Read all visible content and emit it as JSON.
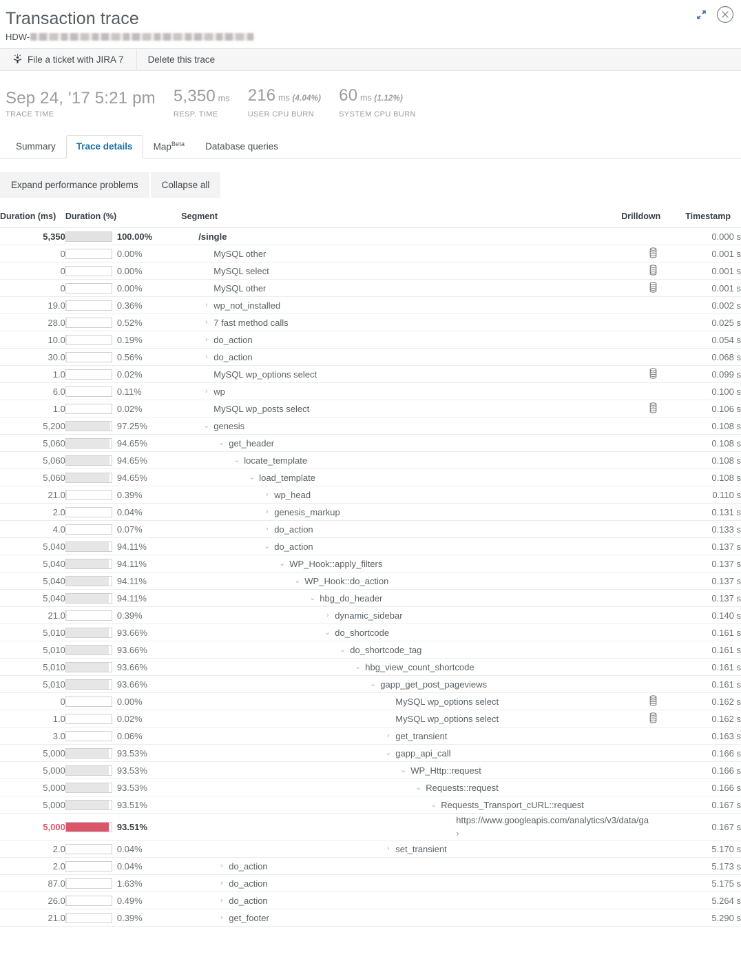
{
  "window": {
    "title": "Transaction trace",
    "subtitle_prefix": "HDW-",
    "expand_icon": "expand-arrows-icon",
    "close_icon": "close-circle-icon"
  },
  "actionbar": {
    "jira_label": "File a ticket with JIRA 7",
    "jira_icon": "jira-person-icon",
    "delete_label": "Delete this trace"
  },
  "metrics": [
    {
      "value": "Sep 24, '17 5:21 pm",
      "unit": "",
      "pct": "",
      "label": "TRACE TIME"
    },
    {
      "value": "5,350",
      "unit": "ms",
      "pct": "",
      "label": "RESP. TIME"
    },
    {
      "value": "216",
      "unit": "ms",
      "pct": "(4.04%)",
      "label": "USER CPU BURN"
    },
    {
      "value": "60",
      "unit": "ms",
      "pct": "(1.12%)",
      "label": "SYSTEM CPU BURN"
    }
  ],
  "tabs": [
    {
      "label": "Summary",
      "sup": "",
      "active": false
    },
    {
      "label": "Trace details",
      "sup": "",
      "active": true
    },
    {
      "label": "Map",
      "sup": "Beta",
      "active": false
    },
    {
      "label": "Database queries",
      "sup": "",
      "active": false
    }
  ],
  "subbar": {
    "expand_label": "Expand performance problems",
    "collapse_label": "Collapse all"
  },
  "table": {
    "headers": {
      "duration_ms": "Duration (ms)",
      "duration_pct": "Duration (%)",
      "segment": "Segment",
      "drilldown": "Drilldown",
      "timestamp": "Timestamp"
    },
    "drilldown_icon": "database-cylinder-icon",
    "chevron_collapsed": "›",
    "chevron_expanded": "⌄",
    "rows": [
      {
        "duration": "5,350",
        "pct": "100.00%",
        "fill": 100,
        "indent": 0,
        "chevron": "none",
        "segment": "/single",
        "drilldown": false,
        "timestamp": "0.000 s",
        "style": "root"
      },
      {
        "duration": "0",
        "pct": "0.00%",
        "fill": 0,
        "indent": 1,
        "chevron": "none",
        "segment": "MySQL other",
        "drilldown": true,
        "timestamp": "0.001 s",
        "style": ""
      },
      {
        "duration": "0",
        "pct": "0.00%",
        "fill": 0,
        "indent": 1,
        "chevron": "none",
        "segment": "MySQL select",
        "drilldown": true,
        "timestamp": "0.001 s",
        "style": ""
      },
      {
        "duration": "0",
        "pct": "0.00%",
        "fill": 0,
        "indent": 1,
        "chevron": "none",
        "segment": "MySQL other",
        "drilldown": true,
        "timestamp": "0.001 s",
        "style": ""
      },
      {
        "duration": "19.0",
        "pct": "0.36%",
        "fill": 0.4,
        "indent": 1,
        "chevron": "collapsed",
        "segment": "wp_not_installed",
        "drilldown": false,
        "timestamp": "0.002 s",
        "style": ""
      },
      {
        "duration": "28.0",
        "pct": "0.52%",
        "fill": 0.5,
        "indent": 1,
        "chevron": "collapsed",
        "segment": "7 fast method calls",
        "drilldown": false,
        "timestamp": "0.025 s",
        "style": ""
      },
      {
        "duration": "10.0",
        "pct": "0.19%",
        "fill": 0.2,
        "indent": 1,
        "chevron": "collapsed",
        "segment": "do_action",
        "drilldown": false,
        "timestamp": "0.054 s",
        "style": ""
      },
      {
        "duration": "30.0",
        "pct": "0.56%",
        "fill": 0.6,
        "indent": 1,
        "chevron": "collapsed",
        "segment": "do_action",
        "drilldown": false,
        "timestamp": "0.068 s",
        "style": ""
      },
      {
        "duration": "1.0",
        "pct": "0.02%",
        "fill": 0,
        "indent": 1,
        "chevron": "none",
        "segment": "MySQL wp_options select",
        "drilldown": true,
        "timestamp": "0.099 s",
        "style": ""
      },
      {
        "duration": "6.0",
        "pct": "0.11%",
        "fill": 0.1,
        "indent": 1,
        "chevron": "collapsed",
        "segment": "wp",
        "drilldown": false,
        "timestamp": "0.100 s",
        "style": ""
      },
      {
        "duration": "1.0",
        "pct": "0.02%",
        "fill": 0,
        "indent": 1,
        "chevron": "none",
        "segment": "MySQL wp_posts select",
        "drilldown": true,
        "timestamp": "0.106 s",
        "style": ""
      },
      {
        "duration": "5,200",
        "pct": "97.25%",
        "fill": 97,
        "indent": 1,
        "chevron": "expanded",
        "segment": "genesis",
        "drilldown": false,
        "timestamp": "0.108 s",
        "style": ""
      },
      {
        "duration": "5,060",
        "pct": "94.65%",
        "fill": 95,
        "indent": 2,
        "chevron": "expanded",
        "segment": "get_header",
        "drilldown": false,
        "timestamp": "0.108 s",
        "style": ""
      },
      {
        "duration": "5,060",
        "pct": "94.65%",
        "fill": 95,
        "indent": 3,
        "chevron": "expanded",
        "segment": "locate_template",
        "drilldown": false,
        "timestamp": "0.108 s",
        "style": ""
      },
      {
        "duration": "5,060",
        "pct": "94.65%",
        "fill": 95,
        "indent": 4,
        "chevron": "expanded",
        "segment": "load_template",
        "drilldown": false,
        "timestamp": "0.108 s",
        "style": ""
      },
      {
        "duration": "21.0",
        "pct": "0.39%",
        "fill": 0.4,
        "indent": 5,
        "chevron": "collapsed",
        "segment": "wp_head",
        "drilldown": false,
        "timestamp": "0.110 s",
        "style": ""
      },
      {
        "duration": "2.0",
        "pct": "0.04%",
        "fill": 0,
        "indent": 5,
        "chevron": "collapsed",
        "segment": "genesis_markup",
        "drilldown": false,
        "timestamp": "0.131 s",
        "style": ""
      },
      {
        "duration": "4.0",
        "pct": "0.07%",
        "fill": 0.1,
        "indent": 5,
        "chevron": "collapsed",
        "segment": "do_action",
        "drilldown": false,
        "timestamp": "0.133 s",
        "style": ""
      },
      {
        "duration": "5,040",
        "pct": "94.11%",
        "fill": 94,
        "indent": 5,
        "chevron": "expanded",
        "segment": "do_action",
        "drilldown": false,
        "timestamp": "0.137 s",
        "style": ""
      },
      {
        "duration": "5,040",
        "pct": "94.11%",
        "fill": 94,
        "indent": 6,
        "chevron": "expanded",
        "segment": "WP_Hook::apply_filters",
        "drilldown": false,
        "timestamp": "0.137 s",
        "style": ""
      },
      {
        "duration": "5,040",
        "pct": "94.11%",
        "fill": 94,
        "indent": 7,
        "chevron": "expanded",
        "segment": "WP_Hook::do_action",
        "drilldown": false,
        "timestamp": "0.137 s",
        "style": ""
      },
      {
        "duration": "5,040",
        "pct": "94.11%",
        "fill": 94,
        "indent": 8,
        "chevron": "expanded",
        "segment": "hbg_do_header",
        "drilldown": false,
        "timestamp": "0.137 s",
        "style": ""
      },
      {
        "duration": "21.0",
        "pct": "0.39%",
        "fill": 0.4,
        "indent": 9,
        "chevron": "collapsed",
        "segment": "dynamic_sidebar",
        "drilldown": false,
        "timestamp": "0.140 s",
        "style": ""
      },
      {
        "duration": "5,010",
        "pct": "93.66%",
        "fill": 94,
        "indent": 9,
        "chevron": "expanded",
        "segment": "do_shortcode",
        "drilldown": false,
        "timestamp": "0.161 s",
        "style": ""
      },
      {
        "duration": "5,010",
        "pct": "93.66%",
        "fill": 94,
        "indent": 10,
        "chevron": "expanded",
        "segment": "do_shortcode_tag",
        "drilldown": false,
        "timestamp": "0.161 s",
        "style": ""
      },
      {
        "duration": "5,010",
        "pct": "93.66%",
        "fill": 94,
        "indent": 11,
        "chevron": "expanded",
        "segment": "hbg_view_count_shortcode",
        "drilldown": false,
        "timestamp": "0.161 s",
        "style": ""
      },
      {
        "duration": "5,010",
        "pct": "93.66%",
        "fill": 94,
        "indent": 12,
        "chevron": "expanded",
        "segment": "gapp_get_post_pageviews",
        "drilldown": false,
        "timestamp": "0.161 s",
        "style": ""
      },
      {
        "duration": "0",
        "pct": "0.00%",
        "fill": 0,
        "indent": 13,
        "chevron": "none",
        "segment": "MySQL wp_options select",
        "drilldown": true,
        "timestamp": "0.162 s",
        "style": ""
      },
      {
        "duration": "1.0",
        "pct": "0.02%",
        "fill": 0,
        "indent": 13,
        "chevron": "none",
        "segment": "MySQL wp_options select",
        "drilldown": true,
        "timestamp": "0.162 s",
        "style": ""
      },
      {
        "duration": "3.0",
        "pct": "0.06%",
        "fill": 0.1,
        "indent": 13,
        "chevron": "collapsed",
        "segment": "get_transient",
        "drilldown": false,
        "timestamp": "0.163 s",
        "style": ""
      },
      {
        "duration": "5,000",
        "pct": "93.53%",
        "fill": 94,
        "indent": 13,
        "chevron": "expanded",
        "segment": "gapp_api_call",
        "drilldown": false,
        "timestamp": "0.166 s",
        "style": ""
      },
      {
        "duration": "5,000",
        "pct": "93.53%",
        "fill": 94,
        "indent": 14,
        "chevron": "expanded",
        "segment": "WP_Http::request",
        "drilldown": false,
        "timestamp": "0.166 s",
        "style": ""
      },
      {
        "duration": "5,000",
        "pct": "93.53%",
        "fill": 94,
        "indent": 15,
        "chevron": "expanded",
        "segment": "Requests::request",
        "drilldown": false,
        "timestamp": "0.166 s",
        "style": ""
      },
      {
        "duration": "5,000",
        "pct": "93.51%",
        "fill": 94,
        "indent": 16,
        "chevron": "expanded",
        "segment": "Requests_Transport_cURL::request",
        "drilldown": false,
        "timestamp": "0.167 s",
        "style": "wrapseg"
      },
      {
        "duration": "5,000",
        "pct": "93.51%",
        "fill": 94,
        "indent": 17,
        "chevron": "none",
        "segment": "https://www.googleapis.com/analytics/v3/data/ga",
        "drilldown": false,
        "timestamp": "0.167 s",
        "style": "alert wrapseg linkarrow"
      },
      {
        "duration": "2.0",
        "pct": "0.04%",
        "fill": 0,
        "indent": 13,
        "chevron": "collapsed",
        "segment": "set_transient",
        "drilldown": false,
        "timestamp": "5.170 s",
        "style": ""
      },
      {
        "duration": "2.0",
        "pct": "0.04%",
        "fill": 0,
        "indent": 2,
        "chevron": "collapsed",
        "segment": "do_action",
        "drilldown": false,
        "timestamp": "5.173 s",
        "style": ""
      },
      {
        "duration": "87.0",
        "pct": "1.63%",
        "fill": 1.7,
        "indent": 2,
        "chevron": "collapsed",
        "segment": "do_action",
        "drilldown": false,
        "timestamp": "5.175 s",
        "style": ""
      },
      {
        "duration": "26.0",
        "pct": "0.49%",
        "fill": 0.5,
        "indent": 2,
        "chevron": "collapsed",
        "segment": "do_action",
        "drilldown": false,
        "timestamp": "5.264 s",
        "style": ""
      },
      {
        "duration": "21.0",
        "pct": "0.39%",
        "fill": 0.4,
        "indent": 2,
        "chevron": "collapsed",
        "segment": "get_footer",
        "drilldown": false,
        "timestamp": "5.290 s",
        "style": ""
      }
    ]
  },
  "colors": {
    "alert": "#d9566a",
    "bar_fill": "#e6e6e6",
    "tab_active": "#1b6fa8",
    "expand_icon": "#3b72b0"
  }
}
